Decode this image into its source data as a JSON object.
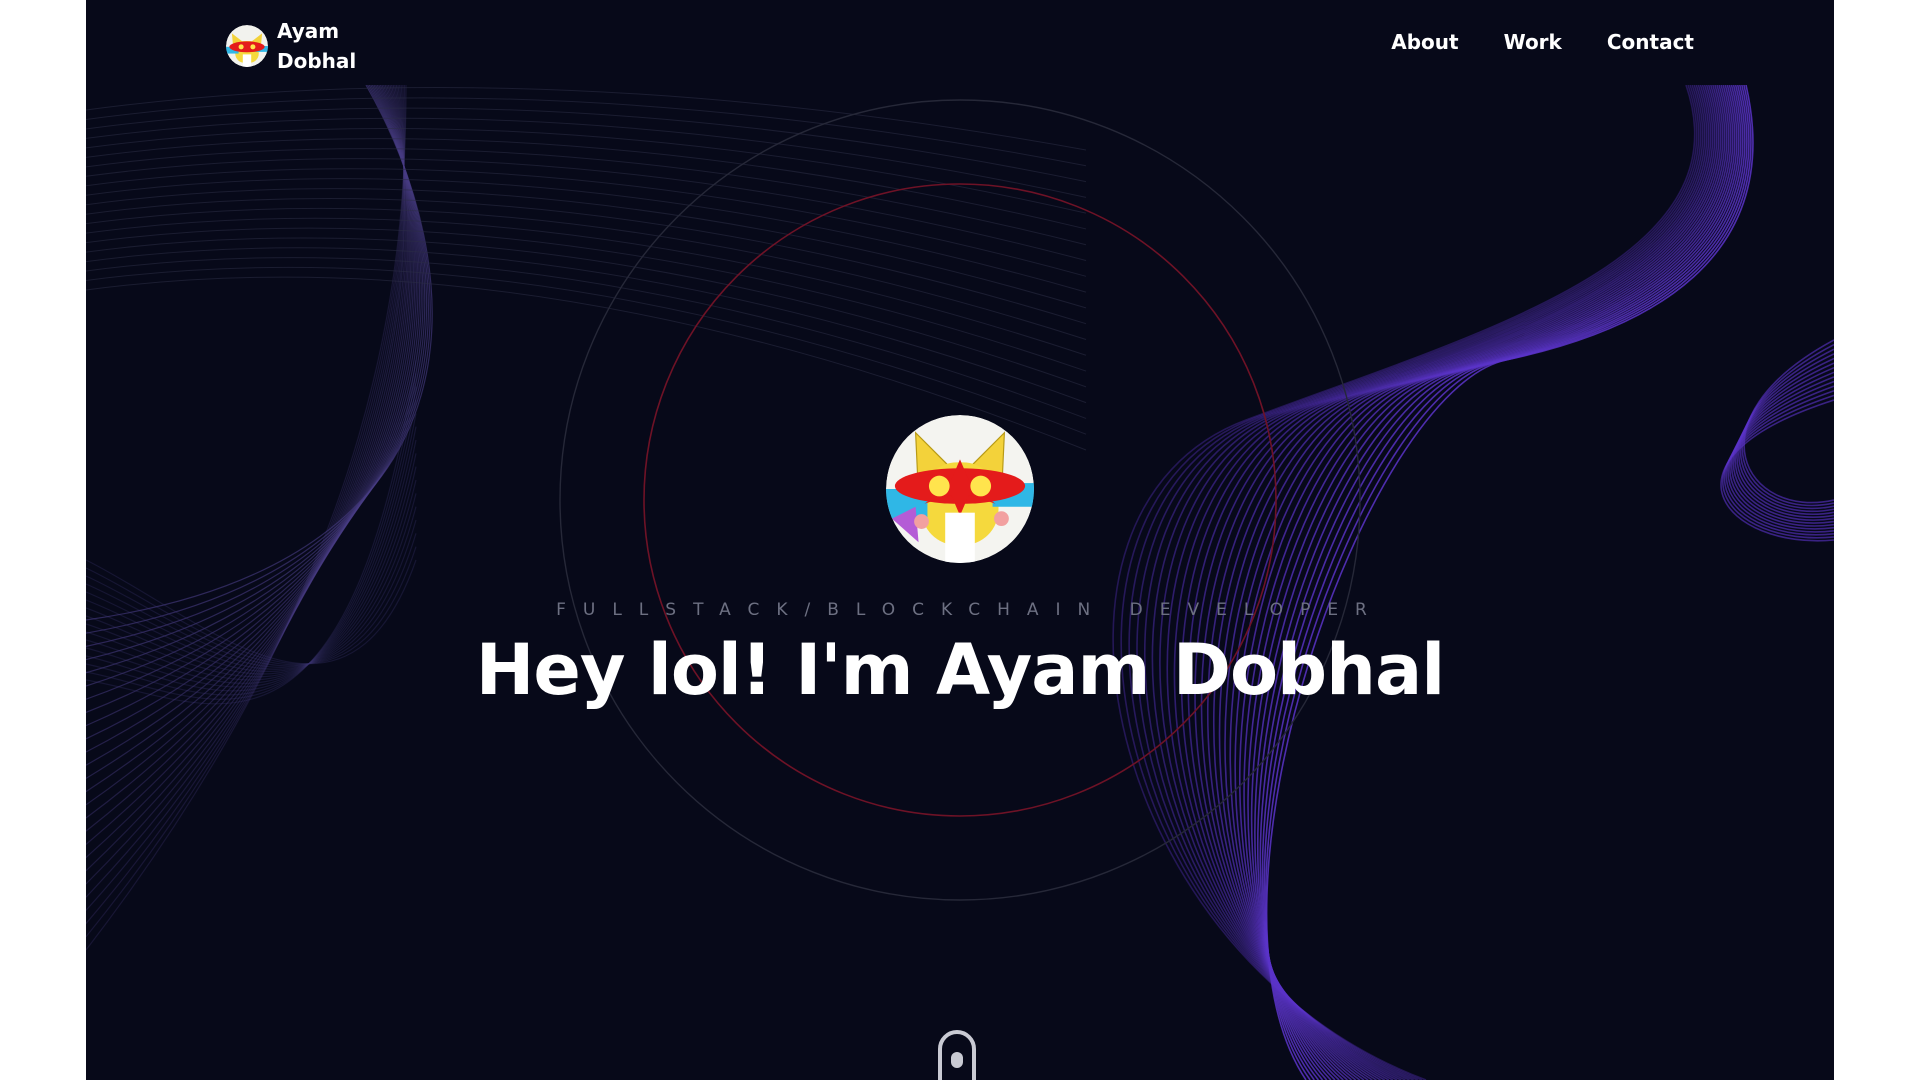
{
  "brand": {
    "name": "Ayam Dobhal",
    "logo_icon": "fox-avatar-icon"
  },
  "nav": {
    "items": [
      {
        "label": "About"
      },
      {
        "label": "Work"
      },
      {
        "label": "Contact"
      }
    ]
  },
  "hero": {
    "avatar_icon": "fox-avatar-icon",
    "subtitle": "FULLSTACK/BLOCKCHAIN DEVELOPER",
    "title": "Hey lol! I'm Ayam Dobhal"
  },
  "scroll": {
    "icon": "mouse-scroll-icon"
  },
  "colors": {
    "background": "#070919",
    "accent_purple": "#5b34c9",
    "accent_red": "#7a1326",
    "text": "#ffffff",
    "subtitle": "#6d7082"
  }
}
